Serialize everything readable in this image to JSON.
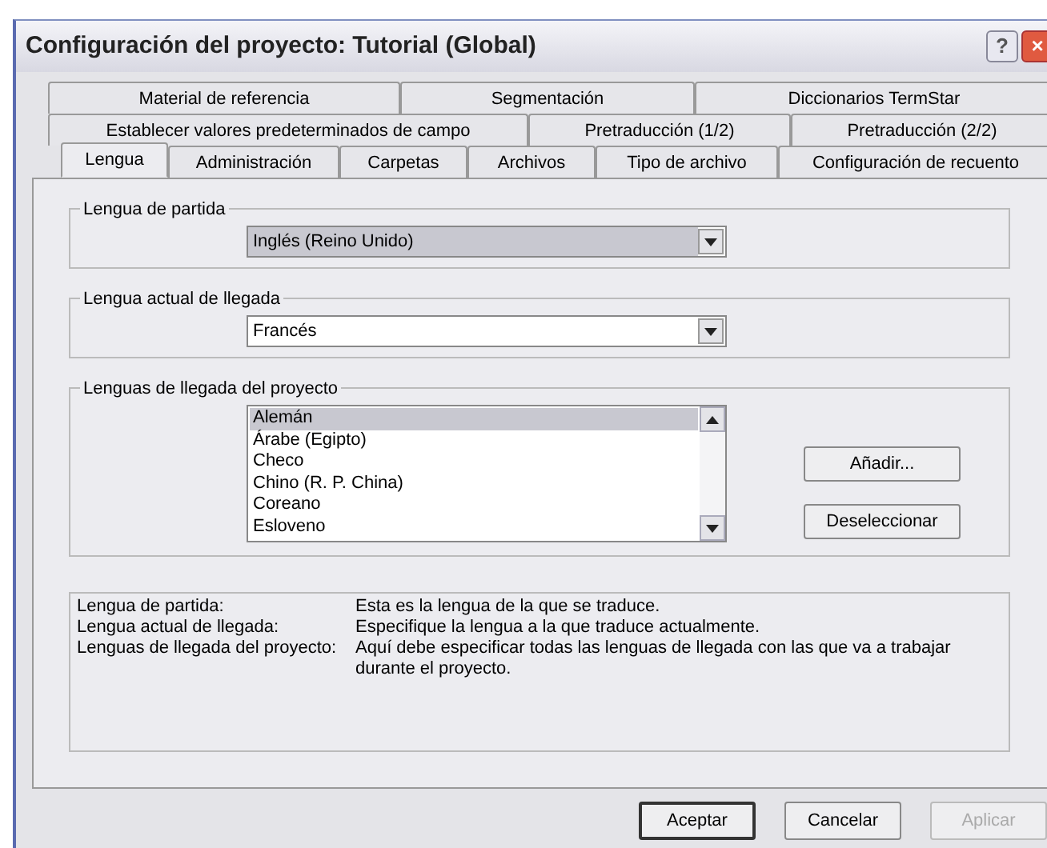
{
  "window": {
    "title": "Configuración del proyecto: Tutorial (Global)",
    "controls": [
      {
        "kind": "help",
        "label": "?"
      },
      {
        "kind": "close",
        "label": "×"
      }
    ]
  },
  "tab_rows": [
    {
      "tabs": [
        {
          "label": "Material de referencia",
          "selected": false
        },
        {
          "label": "Segmentación",
          "selected": false
        },
        {
          "label": "Diccionarios TermStar",
          "selected": false
        }
      ]
    },
    {
      "tabs": [
        {
          "label": "Establecer valores predeterminados de campo",
          "selected": false
        },
        {
          "label": "Pretraducción (1/2)",
          "selected": false
        },
        {
          "label": "Pretraducción (2/2)",
          "selected": false
        }
      ]
    },
    {
      "tabs": [
        {
          "label": "Lengua",
          "selected": true
        },
        {
          "label": "Administración",
          "selected": false
        },
        {
          "label": "Carpetas",
          "selected": false
        },
        {
          "label": "Archivos",
          "selected": false
        },
        {
          "label": "Tipo de archivo",
          "selected": false
        },
        {
          "label": "Configuración de recuento",
          "selected": false
        }
      ]
    }
  ],
  "groups": [
    {
      "kind": "combo",
      "label": "Lengua de partida",
      "value": "Inglés (Reino Unido)",
      "highlighted": true
    },
    {
      "kind": "combo",
      "label": "Lengua actual de llegada",
      "value": "Francés",
      "highlighted": false
    },
    {
      "kind": "list",
      "label": "Lenguas de llegada del proyecto",
      "items": [
        {
          "label": "Alemán",
          "selected": true
        },
        {
          "label": "Árabe (Egipto)",
          "selected": false
        },
        {
          "label": "Checo",
          "selected": false
        },
        {
          "label": "Chino (R. P. China)",
          "selected": false
        },
        {
          "label": "Coreano",
          "selected": false
        },
        {
          "label": "Esloveno",
          "selected": false
        }
      ],
      "buttons": [
        "Añadir...",
        "Deseleccionar"
      ]
    }
  ],
  "info": [
    {
      "term": "Lengua de partida:",
      "text": "Esta es la lengua de la que se traduce."
    },
    {
      "term": "Lengua actual de llegada:",
      "text": "Especifique la lengua a la que traduce actualmente."
    },
    {
      "term": "Lenguas de llegada del proyecto:",
      "text": "Aquí debe especificar todas las lenguas de llegada con las que va a trabajar durante el proyecto."
    }
  ],
  "buttons": [
    {
      "label": "Aceptar",
      "default": true,
      "disabled": false
    },
    {
      "label": "Cancelar",
      "default": false,
      "disabled": false
    },
    {
      "label": "Aplicar",
      "default": false,
      "disabled": true
    }
  ]
}
